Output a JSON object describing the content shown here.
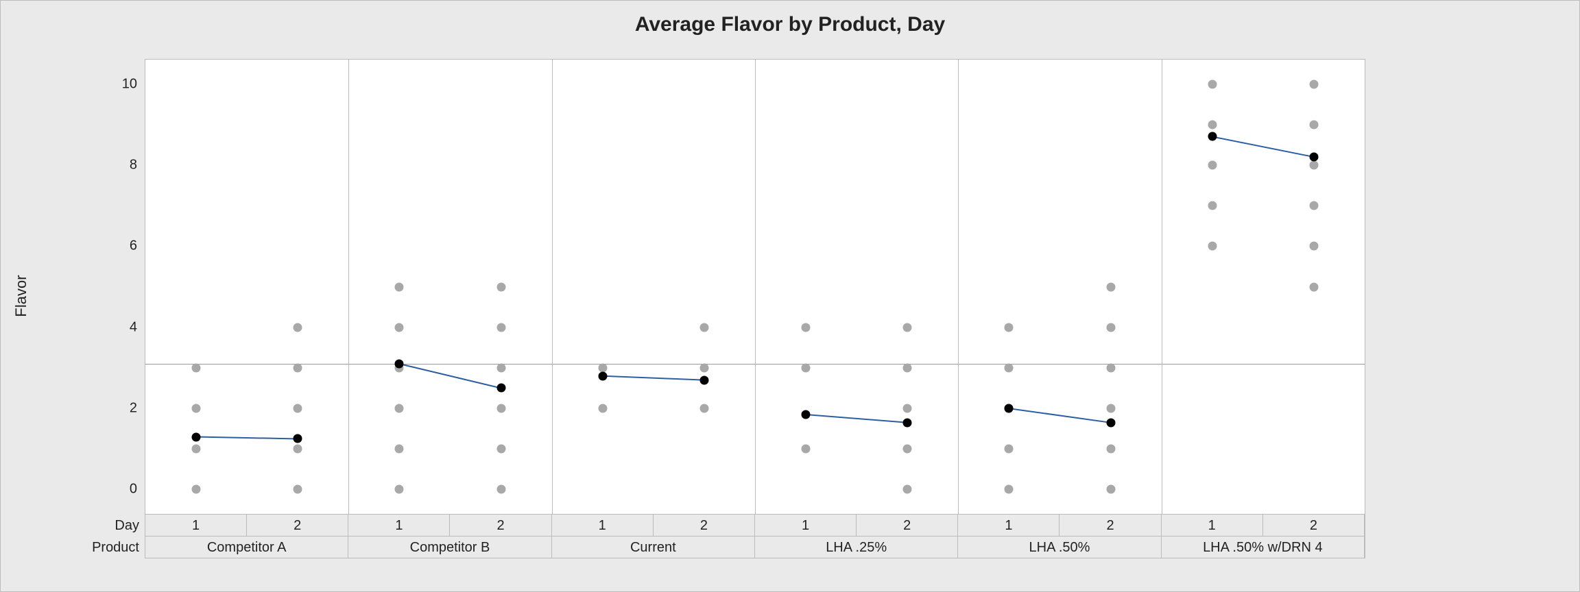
{
  "title": "Average Flavor by Product, Day",
  "ylabel": "Flavor",
  "row_labels": {
    "day": "Day",
    "product": "Product"
  },
  "y_ticks": [
    0,
    2,
    4,
    6,
    8,
    10
  ],
  "y_range": [
    -0.6,
    10.6
  ],
  "overall_mean": 3.1,
  "products": [
    "Competitor A",
    "Competitor B",
    "Current",
    "LHA .25%",
    "LHA .50%",
    "LHA .50% w/DRN 4"
  ],
  "days": [
    "1",
    "2"
  ],
  "chart_data": {
    "type": "scatter",
    "title": "Average Flavor by Product, Day",
    "xlabel": "Product × Day",
    "ylabel": "Flavor",
    "ylim": [
      -0.6,
      10.6
    ],
    "panels": [
      {
        "product": "Competitor A",
        "days": [
          {
            "day": "1",
            "points": [
              0,
              1,
              2,
              3
            ],
            "mean": 1.3
          },
          {
            "day": "2",
            "points": [
              0,
              1,
              2,
              3,
              4
            ],
            "mean": 1.25
          }
        ]
      },
      {
        "product": "Competitor B",
        "days": [
          {
            "day": "1",
            "points": [
              0,
              1,
              2,
              3,
              4,
              5
            ],
            "mean": 3.1
          },
          {
            "day": "2",
            "points": [
              0,
              1,
              2,
              3,
              4,
              5
            ],
            "mean": 2.5
          }
        ]
      },
      {
        "product": "Current",
        "days": [
          {
            "day": "1",
            "points": [
              2,
              3
            ],
            "mean": 2.8
          },
          {
            "day": "2",
            "points": [
              2,
              3,
              4
            ],
            "mean": 2.7
          }
        ]
      },
      {
        "product": "LHA .25%",
        "days": [
          {
            "day": "1",
            "points": [
              1,
              3,
              4
            ],
            "mean": 1.85
          },
          {
            "day": "2",
            "points": [
              0,
              1,
              2,
              3,
              4
            ],
            "mean": 1.65
          }
        ]
      },
      {
        "product": "LHA .50%",
        "days": [
          {
            "day": "1",
            "points": [
              0,
              1,
              2,
              3,
              4
            ],
            "mean": 2.0
          },
          {
            "day": "2",
            "points": [
              0,
              1,
              2,
              3,
              4,
              5
            ],
            "mean": 1.65
          }
        ]
      },
      {
        "product": "LHA .50% w/DRN 4",
        "days": [
          {
            "day": "1",
            "points": [
              6,
              7,
              8,
              9,
              10
            ],
            "mean": 8.7
          },
          {
            "day": "2",
            "points": [
              5,
              6,
              7,
              8,
              9,
              10
            ],
            "mean": 8.2
          }
        ]
      }
    ]
  }
}
